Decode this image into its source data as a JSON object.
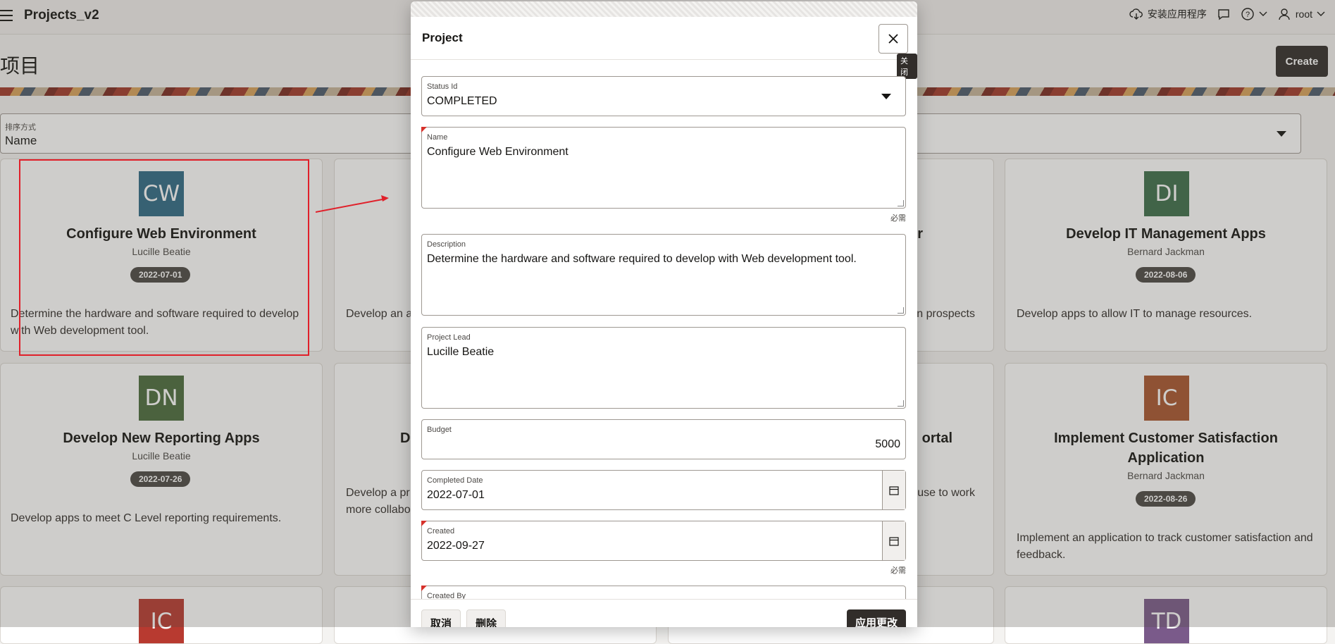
{
  "header": {
    "app_title": "Projects_v2",
    "install_app": "安装应用程序",
    "user": "root"
  },
  "page": {
    "title": "项目",
    "create_label": "Create",
    "sort_label": "排序方式",
    "sort_value": "Name"
  },
  "cards": [
    {
      "initials": "CW",
      "color": "#2e6a85",
      "title": "Configure Web Environment",
      "lead": "Lucille Beatie",
      "date": "2022-07-01",
      "desc": "Determine the hardware and software required to develop with Web development tool."
    },
    {
      "initials": "DI",
      "color": "#3c6e4a",
      "title": "Develop IT Management Apps",
      "lead": "Bernard Jackman",
      "date": "2022-08-06",
      "desc": "Develop apps to allow IT to manage resources."
    },
    {
      "initials": "DN",
      "color": "#4a6b3c",
      "title": "Develop New Reporting Apps",
      "lead": "Lucille Beatie",
      "date": "2022-07-26",
      "desc": "Develop apps to meet C Level reporting requirements."
    },
    {
      "initials": "IC",
      "color": "#a8552e",
      "title": "Implement Customer Satisfaction Application",
      "lead": "Bernard Jackman",
      "date": "2022-08-26",
      "desc": "Implement an application to track customer satisfaction and feedback."
    },
    {
      "initials": "IC",
      "color": "#b83a30"
    },
    {
      "initials": "TD",
      "color": "#7a5a8a"
    }
  ],
  "card_fragments": {
    "mid1_desc": "Develop an a",
    "mid2_desc_right": "n prospects",
    "mid2_title_right": "r",
    "mid3_title_left": "D",
    "mid3_desc_left_1": "Develop a pr",
    "mid3_desc_left_2": "more collabo",
    "mid4_title_right": "ortal",
    "mid4_desc_right": "use to work"
  },
  "dialog": {
    "title": "Project",
    "close_tooltip": "关闭",
    "required_note": "必需",
    "fields": {
      "status_label": "Status Id",
      "status_value": "COMPLETED",
      "name_label": "Name",
      "name_value": "Configure Web Environment",
      "desc_label": "Description",
      "desc_value": "Determine the hardware and software required to develop with Web development tool.",
      "lead_label": "Project Lead",
      "lead_value": "Lucille Beatie",
      "budget_label": "Budget",
      "budget_value": "5000",
      "completed_label": "Completed Date",
      "completed_value": "2022-07-01",
      "created_label": "Created",
      "created_value": "2022-09-27",
      "created_by_label": "Created By"
    },
    "buttons": {
      "cancel": "取消",
      "delete": "删除",
      "apply": "应用更改"
    }
  }
}
